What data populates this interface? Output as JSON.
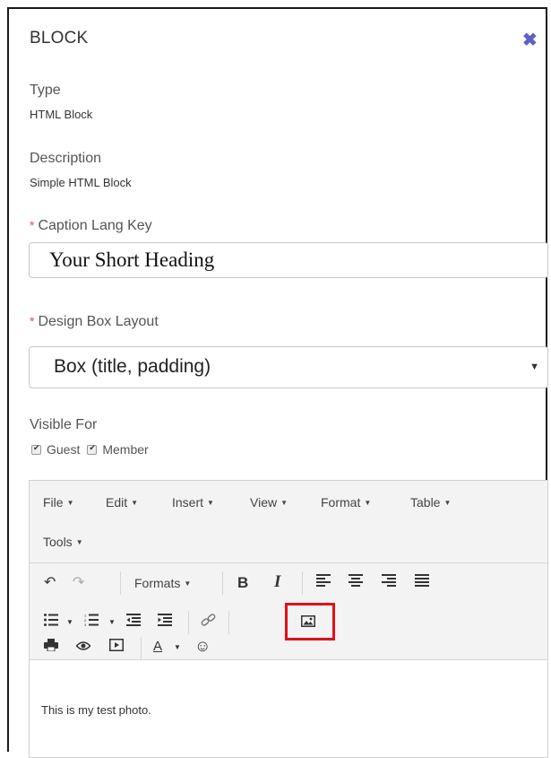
{
  "header": {
    "title": "BLOCK",
    "close_icon": "close-icon"
  },
  "fields": {
    "type_label": "Type",
    "type_value": "HTML Block",
    "description_label": "Description",
    "description_value": "Simple HTML Block",
    "caption_label": "Caption Lang Key",
    "caption_value": "Your Short Heading",
    "layout_label": "Design Box Layout",
    "layout_value": "Box (title, padding)",
    "visible_label": "Visible For",
    "visible_options": [
      "Guest",
      "Member"
    ],
    "required_marker": "*"
  },
  "editor": {
    "menus": [
      "File",
      "Edit",
      "Insert",
      "View",
      "Format",
      "Table",
      "Tools"
    ],
    "formats_label": "Formats",
    "bold_label": "B",
    "italic_label": "I",
    "text_color_label": "A",
    "content": "This is my test photo."
  },
  "colors": {
    "accent": "#5b61c9",
    "required": "#d9534f",
    "highlight": "#e0101a"
  }
}
